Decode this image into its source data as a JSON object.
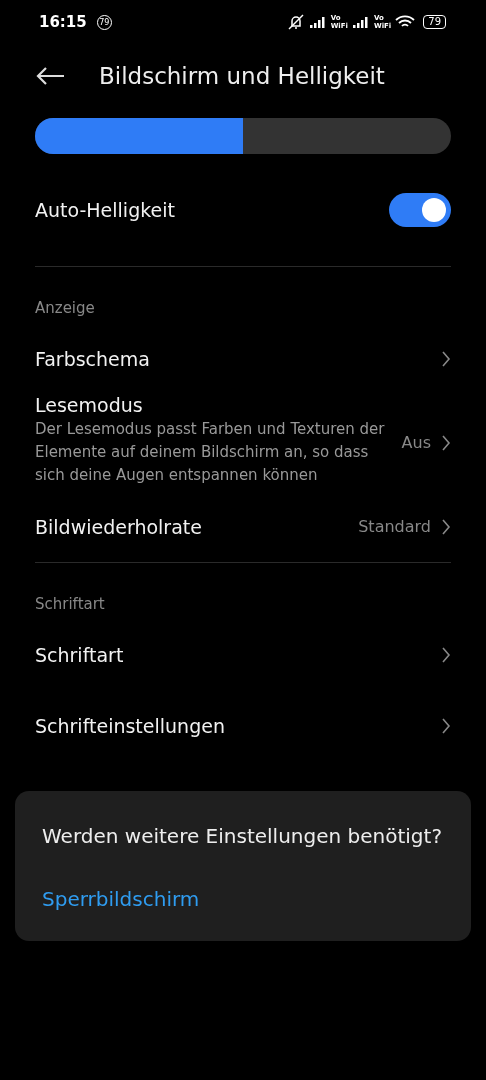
{
  "status_bar": {
    "time": "16:15",
    "notification_count": "79",
    "network_labels": [
      "Vo\nWiFi",
      "Vo\nWiFi"
    ],
    "battery": "79"
  },
  "header": {
    "title": "Bildschirm und Helligkeit"
  },
  "brightness": {
    "level": 0.5
  },
  "auto_brightness": {
    "label": "Auto-Helligkeit",
    "on": true
  },
  "sections": [
    {
      "title": "Anzeige",
      "items": [
        {
          "label": "Farbschema"
        },
        {
          "label": "Lesemodus",
          "description": "Der Lesemodus passt Farben und Texturen der Elemente auf deinem Bildschirm an, so dass sich deine Augen entspannen können",
          "value": "Aus"
        },
        {
          "label": "Bildwiederholrate",
          "value": "Standard"
        }
      ]
    },
    {
      "title": "Schriftart",
      "items": [
        {
          "label": "Schriftart"
        },
        {
          "label": "Schrifteinstellungen"
        }
      ]
    }
  ],
  "suggestion_card": {
    "question": "Werden weitere Einstellungen benötigt?",
    "link": "Sperrbildschirm"
  }
}
